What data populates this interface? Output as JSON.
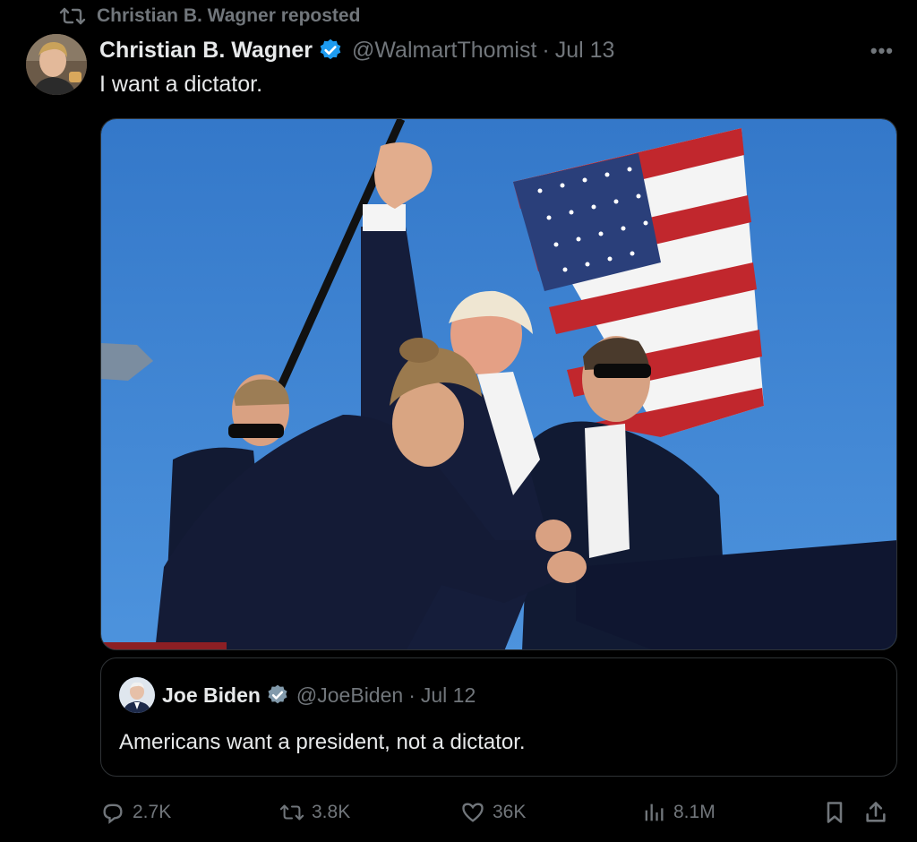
{
  "repost": {
    "label": "Christian B. Wagner reposted",
    "icon": "repost-icon"
  },
  "post": {
    "author_name": "Christian B. Wagner",
    "author_handle": "@WalmartThomist",
    "separator": "·",
    "date": "Jul 13",
    "text": "I want a dictator.",
    "more_icon": "more-icon",
    "more_glyph": "•••"
  },
  "quote": {
    "author_name": "Joe Biden",
    "author_handle": "@JoeBiden",
    "separator": "·",
    "date": "Jul 12",
    "text": "Americans want a president, not a dictator."
  },
  "actions": {
    "replies": "2.7K",
    "reposts": "3.8K",
    "likes": "36K",
    "views": "8.1M"
  },
  "colors": {
    "verified": "#1d9bf0",
    "muted": "#71767b",
    "text": "#e7e9ea",
    "border": "#2f3336"
  }
}
